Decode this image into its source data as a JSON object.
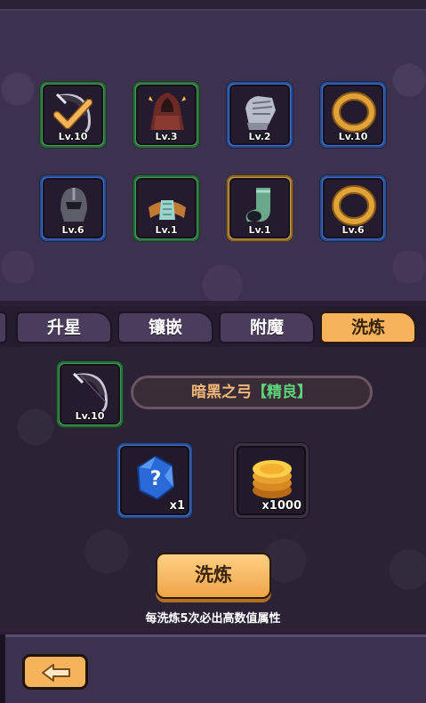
{
  "equipment": [
    {
      "level": "Lv.10",
      "rarity": "green",
      "icon": "dark-bow-icon",
      "equipped": true
    },
    {
      "level": "Lv.3",
      "rarity": "green",
      "icon": "cloak-icon"
    },
    {
      "level": "Lv.2",
      "rarity": "blue",
      "icon": "gauntlet-icon"
    },
    {
      "level": "Lv.10",
      "rarity": "blue",
      "icon": "ring-icon"
    },
    {
      "level": "Lv.6",
      "rarity": "blue",
      "icon": "helmet-icon"
    },
    {
      "level": "Lv.1",
      "rarity": "green",
      "icon": "bracer-icon"
    },
    {
      "level": "Lv.1",
      "rarity": "gold",
      "icon": "boot-icon"
    },
    {
      "level": "Lv.6",
      "rarity": "blue",
      "icon": "ring-icon"
    }
  ],
  "tabs": [
    {
      "label": "升星",
      "active": false
    },
    {
      "label": "镶嵌",
      "active": false
    },
    {
      "label": "附魔",
      "active": false
    },
    {
      "label": "洗炼",
      "active": true
    }
  ],
  "selected_item": {
    "level": "Lv.10",
    "icon": "dark-bow-icon",
    "name": "暗黑之弓",
    "quality": "【精良】"
  },
  "materials": [
    {
      "icon": "mystery-gem-icon",
      "count": "x1"
    },
    {
      "icon": "gold-coins-icon",
      "count": "x1000"
    }
  ],
  "action": {
    "label": "洗炼"
  },
  "hint": "每洗炼5次必出高数值属性",
  "colors": {
    "accent": "#f6b35c",
    "quality": "#5fd37a",
    "item_name": "#f0b87a"
  }
}
